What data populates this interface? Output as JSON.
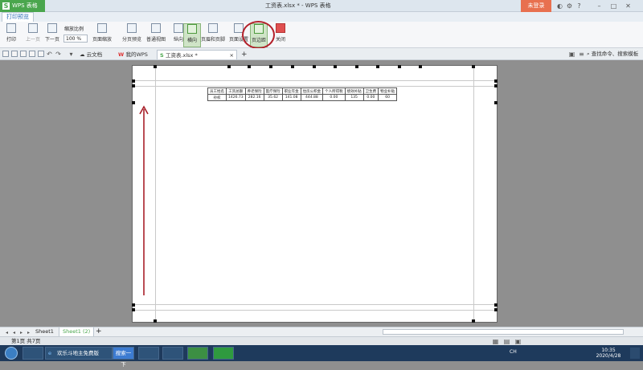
{
  "titlebar": {
    "app_name": "WPS 表格",
    "window_title": "工资表.xlsx * - WPS 表格",
    "login": "未登录"
  },
  "ribbon": {
    "active_tab": "打印预览",
    "buttons": {
      "print": "打印",
      "prev_page": "上一页",
      "next_page": "下一页",
      "zoom_label": "缩放比例",
      "zoom_value": "100 %",
      "page_zoom": "页面缩放",
      "page_break_preview": "分页预览",
      "normal_view": "普通视图",
      "portrait": "纵向",
      "landscape": "横向",
      "header_footer": "页眉和页脚",
      "page_setup": "页面设置",
      "margins": "页边距",
      "close": "关闭"
    }
  },
  "docbar": {
    "tabs": [
      "云文档",
      "我的WPS",
      "工资表.xlsx *"
    ],
    "add_tab": "+",
    "search": "查找命令、搜索模板"
  },
  "sheet": {
    "headers": [
      "员工姓名",
      "工资总额",
      "养老保险",
      "医疗保险",
      "职业年金",
      "住房公积金",
      "个人所得税",
      "绩效补贴",
      "卫生费",
      "物业补贴"
    ],
    "row": [
      "孙权",
      "1426.73",
      "282.16",
      "35.62",
      "141.08",
      "444.88",
      "0.00",
      "135",
      "0.00",
      "60"
    ]
  },
  "sheet_tabs": [
    "Sheet1",
    "Sheet1 (2)"
  ],
  "status": {
    "page_info": "第1页 共7页"
  },
  "taskbar": {
    "ie_task": "欢乐斗地主免费版",
    "search_button": "搜索一下",
    "ime": "CH",
    "time": "10:35",
    "date": "2020/4/28"
  },
  "colors": {
    "accent_green": "#4aa64d",
    "login_orange": "#e8704f",
    "highlight_red": "#b3202a",
    "arrow_red": "#a8202a"
  }
}
